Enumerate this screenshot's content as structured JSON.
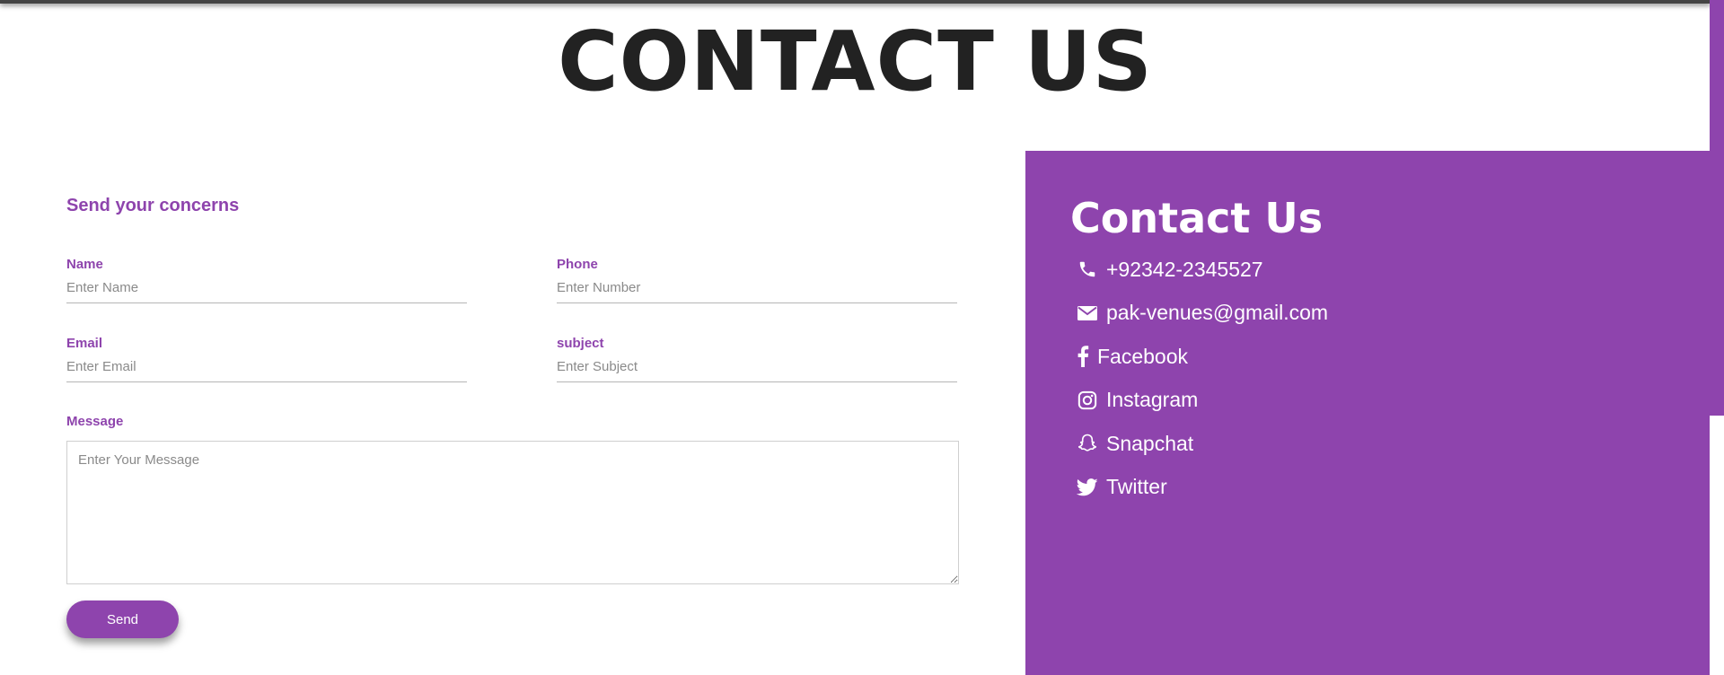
{
  "page": {
    "title": "CONTACT US"
  },
  "form": {
    "heading": "Send your concerns",
    "fields": [
      {
        "label": "Name",
        "placeholder": "Enter Name"
      },
      {
        "label": "Phone",
        "placeholder": "Enter Number"
      },
      {
        "label": "Email",
        "placeholder": "Enter Email"
      },
      {
        "label": "subject",
        "placeholder": "Enter Subject"
      }
    ],
    "message": {
      "label": "Message",
      "placeholder": "Enter Your Message"
    },
    "send_label": "Send"
  },
  "contact": {
    "title": "Contact Us",
    "items": [
      {
        "icon": "phone-icon",
        "text": "+92342-2345527"
      },
      {
        "icon": "envelope-icon",
        "text": "pak-venues@gmail.com"
      },
      {
        "icon": "facebook-icon",
        "text": "Facebook"
      },
      {
        "icon": "instagram-icon",
        "text": "Instagram"
      },
      {
        "icon": "snapchat-icon",
        "text": "Snapchat"
      },
      {
        "icon": "twitter-icon",
        "text": "Twitter"
      }
    ]
  },
  "colors": {
    "accent": "#8e44ad",
    "title": "#222222",
    "text_on_accent": "#ffffff"
  }
}
